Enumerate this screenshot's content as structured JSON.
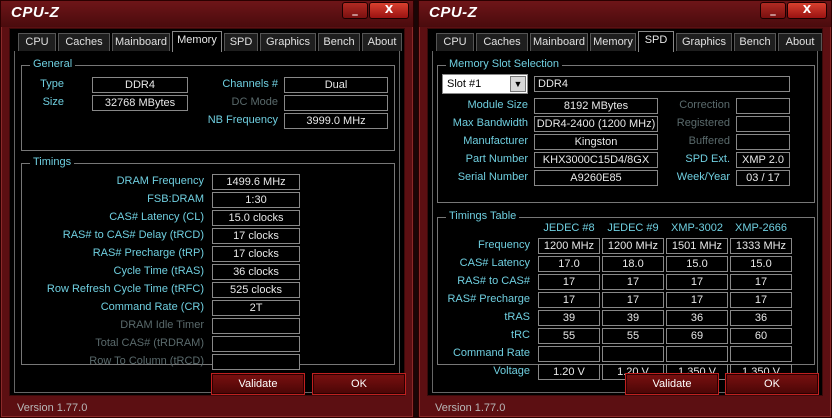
{
  "app": {
    "title": "CPU-Z",
    "minimize_glyph": "_",
    "close_glyph": "X",
    "version": "Version 1.77.0",
    "tabs": [
      "CPU",
      "Caches",
      "Mainboard",
      "Memory",
      "SPD",
      "Graphics",
      "Bench",
      "About"
    ]
  },
  "memory": {
    "active_tab": "Memory",
    "general": {
      "title": "General",
      "type_label": "Type",
      "type_value": "DDR4",
      "size_label": "Size",
      "size_value": "32768 MBytes",
      "channels_label": "Channels #",
      "channels_value": "Dual",
      "dcmode_label": "DC Mode",
      "dcmode_value": "",
      "nbfreq_label": "NB Frequency",
      "nbfreq_value": "3999.0 MHz"
    },
    "timings": {
      "title": "Timings",
      "rows": [
        {
          "label": "DRAM Frequency",
          "value": "1499.6 MHz",
          "dim": false
        },
        {
          "label": "FSB:DRAM",
          "value": "1:30",
          "dim": false
        },
        {
          "label": "CAS# Latency (CL)",
          "value": "15.0 clocks",
          "dim": false
        },
        {
          "label": "RAS# to CAS# Delay (tRCD)",
          "value": "17 clocks",
          "dim": false
        },
        {
          "label": "RAS# Precharge (tRP)",
          "value": "17 clocks",
          "dim": false
        },
        {
          "label": "Cycle Time (tRAS)",
          "value": "36 clocks",
          "dim": false
        },
        {
          "label": "Row Refresh Cycle Time (tRFC)",
          "value": "525 clocks",
          "dim": false
        },
        {
          "label": "Command Rate (CR)",
          "value": "2T",
          "dim": false
        },
        {
          "label": "DRAM Idle Timer",
          "value": "",
          "dim": true
        },
        {
          "label": "Total CAS# (tRDRAM)",
          "value": "",
          "dim": true
        },
        {
          "label": "Row To Column (tRCD)",
          "value": "",
          "dim": true
        }
      ]
    },
    "validate": "Validate",
    "ok": "OK"
  },
  "spd": {
    "active_tab": "SPD",
    "slot_group_title": "Memory Slot Selection",
    "slot_selected": "Slot #1",
    "slot_type": "DDR4",
    "left_rows": [
      {
        "label": "Module Size",
        "value": "8192 MBytes"
      },
      {
        "label": "Max Bandwidth",
        "value": "DDR4-2400 (1200 MHz)"
      },
      {
        "label": "Manufacturer",
        "value": "Kingston"
      },
      {
        "label": "Part Number",
        "value": "KHX3000C15D4/8GX"
      },
      {
        "label": "Serial Number",
        "value": "A9260E85"
      }
    ],
    "right_rows": [
      {
        "label": "Correction",
        "value": "",
        "dim": true
      },
      {
        "label": "Registered",
        "value": "",
        "dim": true
      },
      {
        "label": "Buffered",
        "value": "",
        "dim": true
      },
      {
        "label": "SPD Ext.",
        "value": "XMP 2.0",
        "dim": false
      },
      {
        "label": "Week/Year",
        "value": "03 / 17",
        "dim": false
      }
    ],
    "timings_table": {
      "title": "Timings Table",
      "columns": [
        "JEDEC #8",
        "JEDEC #9",
        "XMP-3002",
        "XMP-2666"
      ],
      "rows": [
        {
          "label": "Frequency",
          "values": [
            "1200 MHz",
            "1200 MHz",
            "1501 MHz",
            "1333 MHz"
          ]
        },
        {
          "label": "CAS# Latency",
          "values": [
            "17.0",
            "18.0",
            "15.0",
            "15.0"
          ]
        },
        {
          "label": "RAS# to CAS#",
          "values": [
            "17",
            "17",
            "17",
            "17"
          ]
        },
        {
          "label": "RAS# Precharge",
          "values": [
            "17",
            "17",
            "17",
            "17"
          ]
        },
        {
          "label": "tRAS",
          "values": [
            "39",
            "39",
            "36",
            "36"
          ]
        },
        {
          "label": "tRC",
          "values": [
            "55",
            "55",
            "69",
            "60"
          ]
        },
        {
          "label": "Command Rate",
          "values": [
            "",
            "",
            "",
            ""
          ]
        },
        {
          "label": "Voltage",
          "values": [
            "1.20 V",
            "1.20 V",
            "1.350 V",
            "1.350 V"
          ]
        }
      ]
    },
    "validate": "Validate",
    "ok": "OK"
  }
}
